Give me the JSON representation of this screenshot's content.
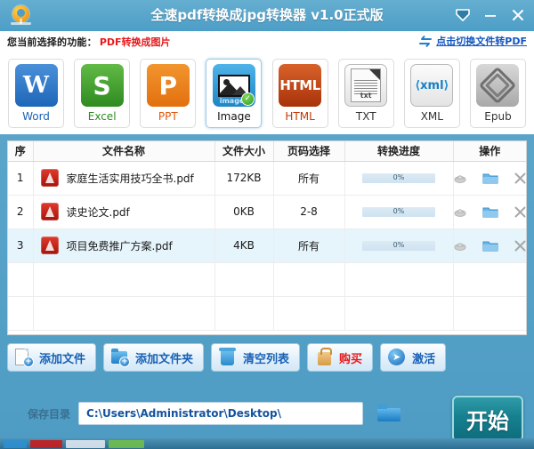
{
  "window": {
    "title": "全速pdf转换成jpg转换器 v1.0正式版",
    "logo_icon": "refresh-circle-logo",
    "buttons": [
      {
        "name": "collapse-to-tray-button",
        "icon": "chevron-down-icon"
      },
      {
        "name": "minimize-button",
        "icon": "minimize-icon"
      },
      {
        "name": "close-button",
        "icon": "close-icon"
      }
    ]
  },
  "func_bar": {
    "label": "您当前选择的功能：",
    "value": "PDF转换成图片",
    "switch_link": "点击切换文件转PDF",
    "switch_icon": "swap-arrows-icon",
    "value_color": "#e8191b",
    "link_color": "#1356c0"
  },
  "formats": [
    {
      "id": "word",
      "caption": "Word",
      "glyph": "W",
      "selected": false
    },
    {
      "id": "excel",
      "caption": "Excel",
      "glyph": "S",
      "selected": false
    },
    {
      "id": "ppt",
      "caption": "PPT",
      "glyph": "P",
      "selected": false
    },
    {
      "id": "image",
      "caption": "Image",
      "glyph": "images",
      "selected": true
    },
    {
      "id": "html",
      "caption": "HTML",
      "glyph": "HTML",
      "selected": false
    },
    {
      "id": "txt",
      "caption": "TXT",
      "glyph": "txt",
      "selected": false
    },
    {
      "id": "xml",
      "caption": "XML",
      "glyph": "xml",
      "selected": false
    },
    {
      "id": "epub",
      "caption": "Epub",
      "glyph": "",
      "selected": false
    }
  ],
  "table": {
    "headers": {
      "index": "序",
      "filename": "文件名称",
      "filesize": "文件大小",
      "pages": "页码选择",
      "progress": "转换进度",
      "operations": "操作"
    },
    "rows": [
      {
        "index": "1",
        "filename": "家庭生活实用技巧全书.pdf",
        "filesize": "172KB",
        "pages": "所有",
        "progress": "0%",
        "selected": false
      },
      {
        "index": "2",
        "filename": "读史论文.pdf",
        "filesize": "0KB",
        "pages": "2-8",
        "progress": "0%",
        "selected": false
      },
      {
        "index": "3",
        "filename": "项目免费推广方案.pdf",
        "filesize": "4KB",
        "pages": "所有",
        "progress": "0%",
        "selected": true
      }
    ],
    "empty_rows": 2,
    "row_ops": [
      {
        "name": "preview-icon",
        "title": "preview"
      },
      {
        "name": "open-folder-icon",
        "title": "open folder"
      },
      {
        "name": "remove-icon",
        "title": "remove"
      }
    ],
    "selected_row_color": "#e6f4fb"
  },
  "actions": [
    {
      "id": "add-file",
      "label": "添加文件",
      "icon": "document-plus-icon",
      "red": false
    },
    {
      "id": "add-folder",
      "label": "添加文件夹",
      "icon": "folder-plus-icon",
      "red": false
    },
    {
      "id": "clear-list",
      "label": "清空列表",
      "icon": "trash-icon",
      "red": false
    },
    {
      "id": "buy",
      "label": "购买",
      "icon": "shopping-bag-icon",
      "red": true
    },
    {
      "id": "activate",
      "label": "激活",
      "icon": "arrow-right-icon",
      "red": false
    }
  ],
  "save": {
    "label": "保存目录",
    "path": "C:\\Users\\Administrator\\Desktop\\",
    "browse_icon": "folder-icon",
    "start_label": "开始",
    "start_color": "#17808f"
  },
  "taskbar": {
    "items": [
      {
        "color": "#2f8fd0",
        "width": 26
      },
      {
        "color": "#c81d1d",
        "width": 36
      },
      {
        "color": "#dfe7ee",
        "width": 44
      },
      {
        "color": "#6fbf4a",
        "width": 40
      }
    ]
  }
}
